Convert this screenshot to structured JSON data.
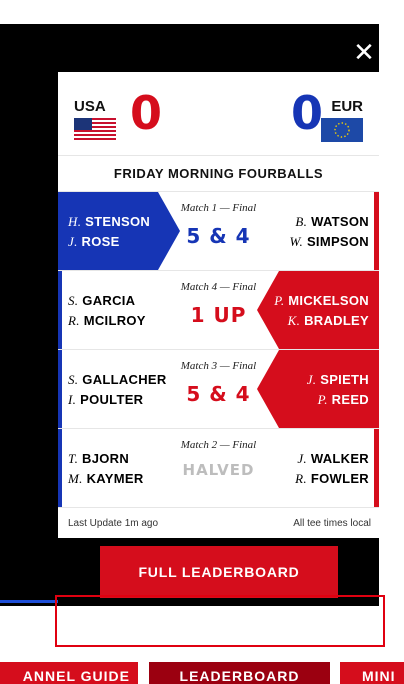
{
  "close_glyph": "✕",
  "score": {
    "usa": {
      "label": "USA",
      "points": "0"
    },
    "eur": {
      "label": "EUR",
      "points": "0"
    }
  },
  "session_title": "FRIDAY MORNING FOURBALLS",
  "matches": [
    {
      "label": "Match 1 — Final",
      "result": "5 & 4",
      "winner": "eur",
      "left": [
        {
          "initial": "H.",
          "surname": "STENSON"
        },
        {
          "initial": "J.",
          "surname": "ROSE"
        }
      ],
      "right": [
        {
          "initial": "B.",
          "surname": "WATSON"
        },
        {
          "initial": "W.",
          "surname": "SIMPSON"
        }
      ]
    },
    {
      "label": "Match 4 — Final",
      "result": "1 UP",
      "winner": "usa",
      "left": [
        {
          "initial": "S.",
          "surname": "GARCIA"
        },
        {
          "initial": "R.",
          "surname": "MCILROY"
        }
      ],
      "right": [
        {
          "initial": "P.",
          "surname": "MICKELSON"
        },
        {
          "initial": "K.",
          "surname": "BRADLEY"
        }
      ]
    },
    {
      "label": "Match 3 — Final",
      "result": "5 & 4",
      "winner": "usa",
      "left": [
        {
          "initial": "S.",
          "surname": "GALLACHER"
        },
        {
          "initial": "I.",
          "surname": "POULTER"
        }
      ],
      "right": [
        {
          "initial": "J.",
          "surname": "SPIETH"
        },
        {
          "initial": "P.",
          "surname": "REED"
        }
      ]
    },
    {
      "label": "Match 2 — Final",
      "result": "HALVED",
      "winner": "none",
      "left": [
        {
          "initial": "T.",
          "surname": "BJORN"
        },
        {
          "initial": "M.",
          "surname": "KAYMER"
        }
      ],
      "right": [
        {
          "initial": "J.",
          "surname": "WALKER"
        },
        {
          "initial": "R.",
          "surname": "FOWLER"
        }
      ]
    }
  ],
  "footer": {
    "last_update": "Last Update 1m ago",
    "timezone_note": "All tee times local"
  },
  "leaderboard_button": "FULL LEADERBOARD",
  "nav": {
    "item1": "ANNEL GUIDE",
    "item2": "LEADERBOARD",
    "item3": "MINI"
  },
  "colors": {
    "usa_red": "#d50d1c",
    "eur_blue": "#1635b5",
    "halved_grey": "#bdbdbd"
  }
}
